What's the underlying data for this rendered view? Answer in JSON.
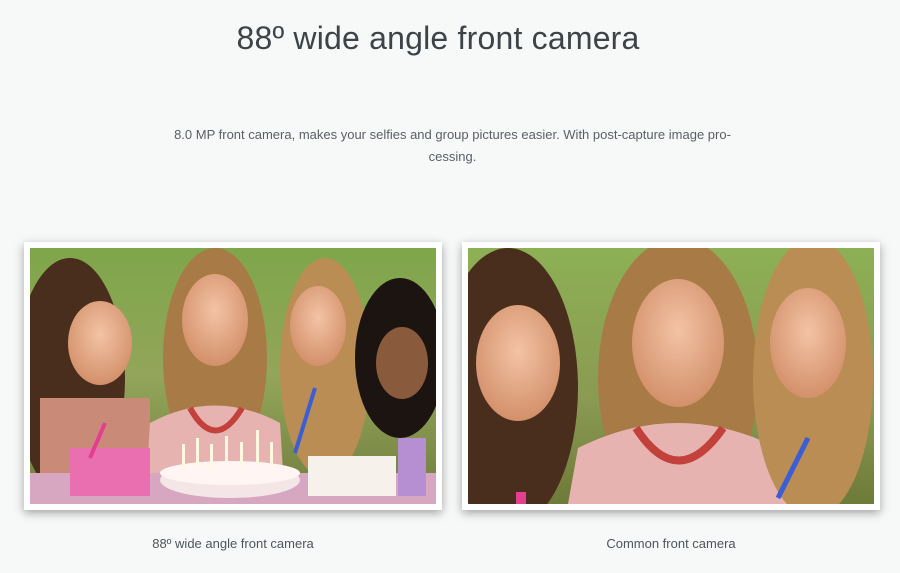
{
  "heading": "88º wide angle front camera",
  "description": "8.0 MP front camera, makes your selfies and group pictures easier. With post-capture image pro- cessing.",
  "photos": [
    {
      "caption": "88º wide angle front camera"
    },
    {
      "caption": "Common front camera"
    }
  ]
}
